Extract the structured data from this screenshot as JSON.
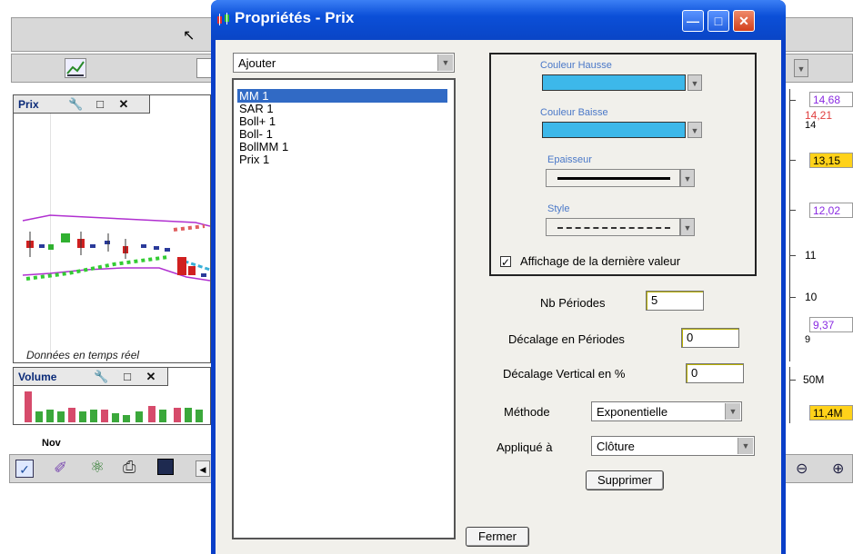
{
  "background_app": {
    "price_panel": {
      "title": "Prix",
      "footer_note": "Données en temps réel"
    },
    "volume_panel": {
      "title": "Volume",
      "x_label": "Nov"
    },
    "price_axis": [
      {
        "text": "14,68",
        "color": "#8a2be2",
        "boxed": true
      },
      {
        "text": "14,21",
        "color": "#e04040",
        "boxed": false
      },
      {
        "text": "14",
        "color": "#000000",
        "boxed": false
      },
      {
        "text": "13,15",
        "color": "#000000",
        "boxed": true,
        "bg": "#ffd21a"
      },
      {
        "text": "12,02",
        "color": "#8a2be2",
        "boxed": true
      },
      {
        "text": "11",
        "color": "#000000",
        "boxed": false
      },
      {
        "text": "10",
        "color": "#000000",
        "boxed": false
      },
      {
        "text": "9,37",
        "color": "#8a2be2",
        "boxed": true
      },
      {
        "text": "9",
        "color": "#000000",
        "boxed": false
      }
    ],
    "volume_axis": [
      {
        "text": "50M"
      },
      {
        "text": "11,4M"
      }
    ]
  },
  "dialog": {
    "title": "Propriétés - Prix",
    "add_combo": {
      "value": "Ajouter"
    },
    "indicators": [
      "MM 1",
      "SAR 1",
      "Boll+ 1",
      "Boll- 1",
      "BollMM 1",
      "Prix 1"
    ],
    "selected_index": 0,
    "styles": {
      "color_up_label": "Couleur Hausse",
      "color_down_label": "Couleur Baisse",
      "thickness_label": "Epaisseur",
      "style_label": "Style",
      "swatch_color": "#3db8ea",
      "show_last_value_label": "Affichage de la dernière valeur",
      "show_last_value_checked": true
    },
    "form": {
      "periods_label": "Nb Périodes",
      "periods_value": "5",
      "offset_periods_label": "Décalage en Périodes",
      "offset_periods_value": "0",
      "offset_vertical_label": "Décalage Vertical en %",
      "offset_vertical_value": "0",
      "method_label": "Méthode",
      "method_value": "Exponentielle",
      "applied_label": "Appliqué à",
      "applied_value": "Clôture"
    },
    "delete_button": "Supprimer",
    "close_button": "Fermer"
  }
}
